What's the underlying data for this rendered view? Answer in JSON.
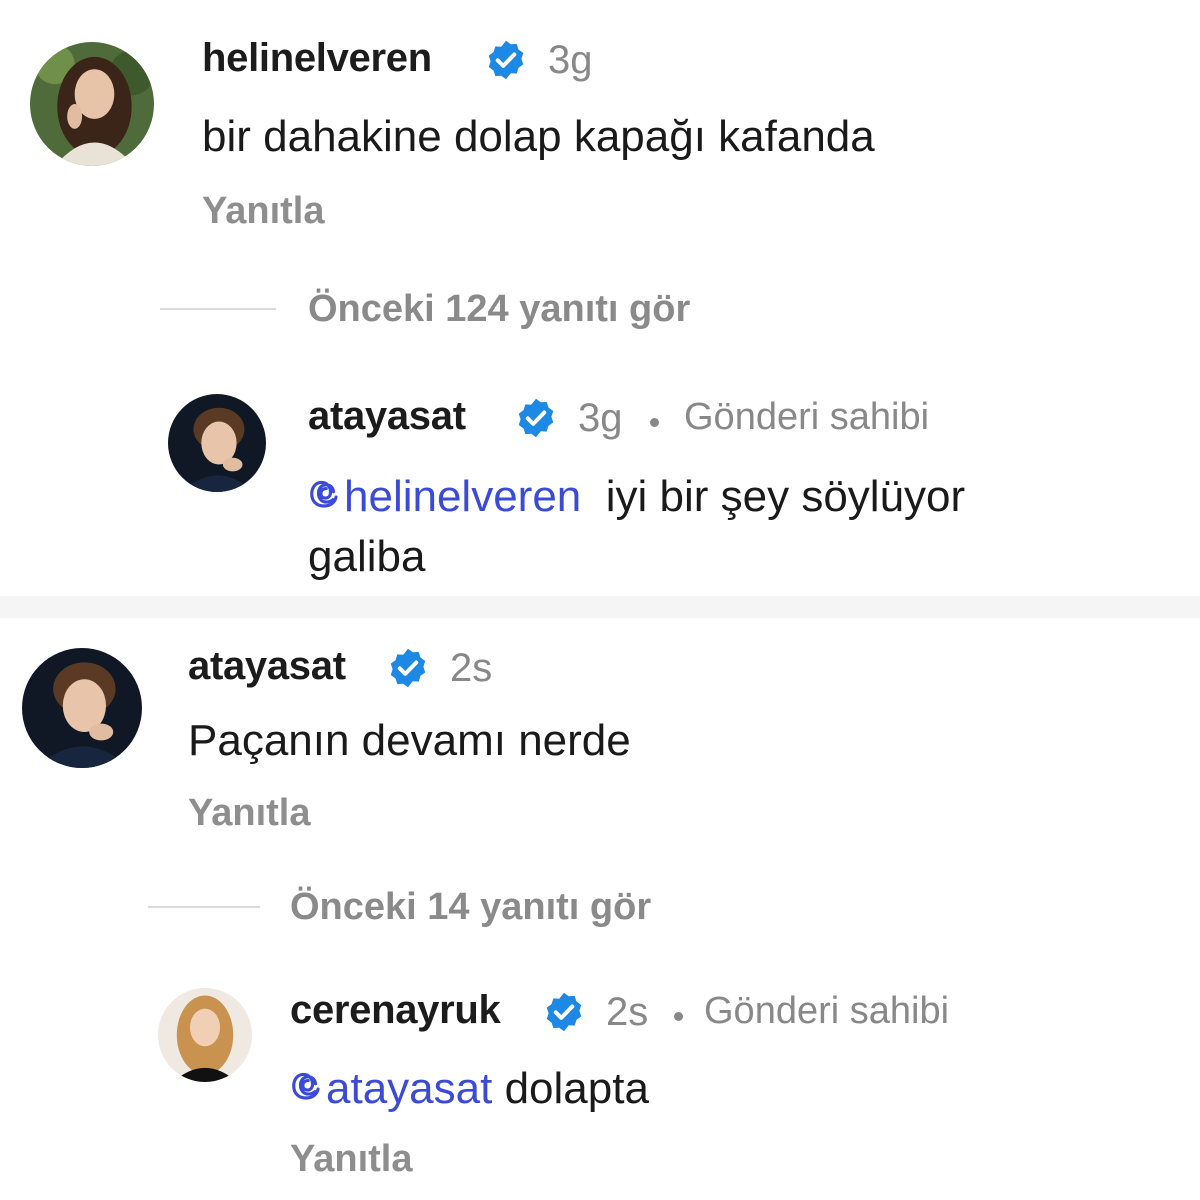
{
  "accent": "#1e88e5",
  "mention_color": "#3b4bd8",
  "icons": {
    "verified": "verified-badge-icon",
    "mention": "threads-at-icon"
  },
  "thread1": {
    "comment": {
      "username": "helinelveren",
      "time": "3g",
      "text": "bir dahakine dolap kapağı kafanda",
      "reply": "Yanıtla"
    },
    "more_replies": "Önceki 124 yanıtı gör",
    "reply": {
      "username": "atayasat",
      "time": "3g",
      "owner_label": "Gönderi sahibi",
      "mention": "helinelveren",
      "text_line1": "iyi bir şey söylüyor",
      "text_line2": "galiba"
    }
  },
  "thread2": {
    "comment": {
      "username": "atayasat",
      "time": "2s",
      "text": "Paçanın devamı nerde",
      "reply": "Yanıtla"
    },
    "more_replies": "Önceki 14 yanıtı gör",
    "reply": {
      "username": "cerenayruk",
      "time": "2s",
      "owner_label": "Gönderi sahibi",
      "mention": "atayasat",
      "text": "dolapta",
      "reply": "Yanıtla"
    }
  }
}
